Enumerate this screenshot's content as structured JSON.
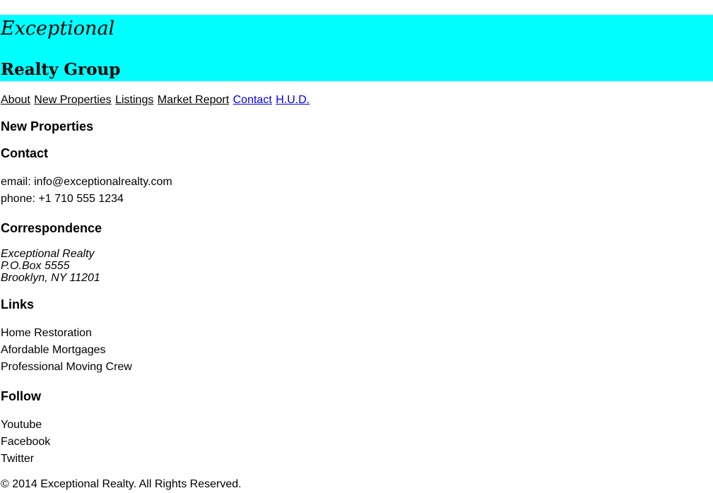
{
  "header": {
    "logo_line1": "Exceptional",
    "logo_line2": "Realty Group",
    "background": "#00ffff"
  },
  "nav": [
    {
      "label": "About"
    },
    {
      "label": "New Properties"
    },
    {
      "label": "Listings"
    },
    {
      "label": "Market Report"
    },
    {
      "label": "Contact"
    },
    {
      "label": "H.U.D."
    }
  ],
  "sections": {
    "new_properties": {
      "heading": "New Properties"
    },
    "contact": {
      "heading": "Contact",
      "email": "email: info@exceptionalrealty.com",
      "phone": "phone: +1 710 555 1234"
    },
    "correspondence": {
      "heading": "Correspondence",
      "lines": [
        "Exceptional Realty",
        "P.O.Box 5555",
        "Brooklyn, NY 11201"
      ]
    },
    "links": {
      "heading": "Links",
      "items": [
        "Home Restoration",
        "Afordable Mortgages",
        "Professional Moving Crew"
      ]
    },
    "follow": {
      "heading": "Follow",
      "items": [
        "Youtube",
        "Facebook",
        "Twitter"
      ]
    }
  },
  "footer": {
    "copyright": "© 2014 Exceptional Realty. All Rights Reserved."
  }
}
